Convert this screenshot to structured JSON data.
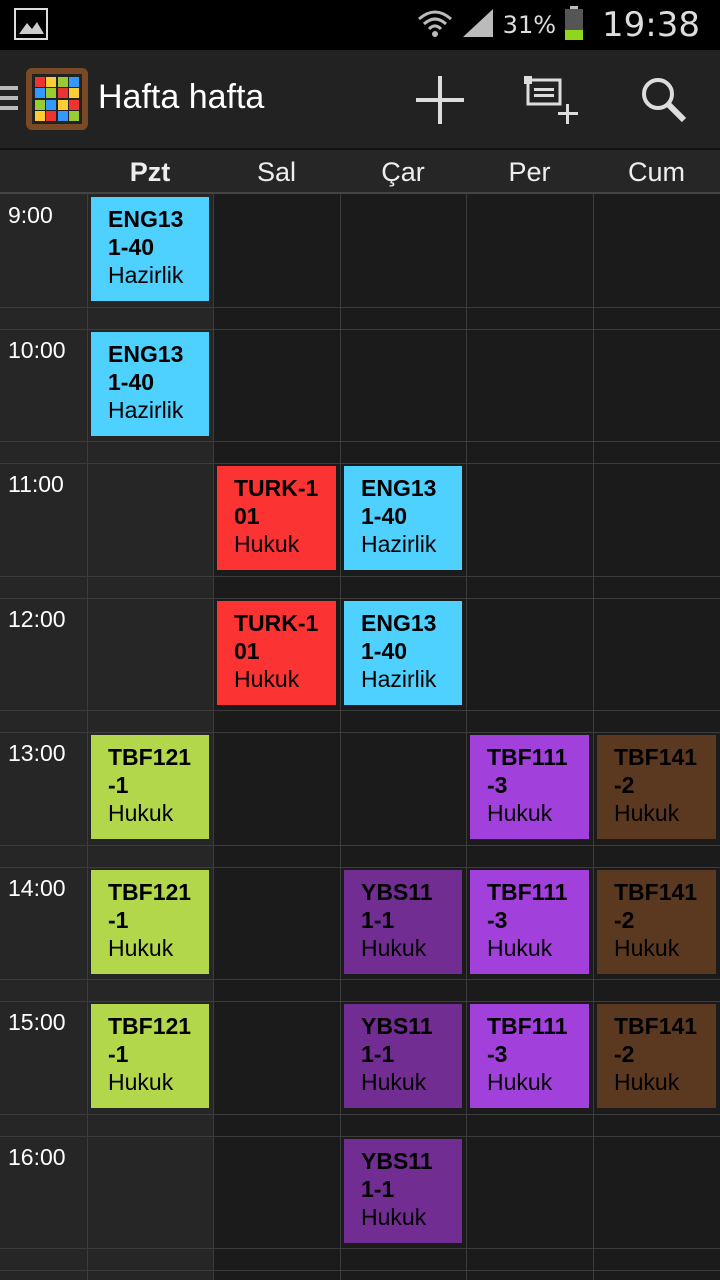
{
  "status_bar": {
    "battery_percent": "31%",
    "time": "19:38",
    "icons": [
      "image-icon",
      "wifi-icon",
      "signal-icon",
      "battery-icon"
    ]
  },
  "action_bar": {
    "title": "Hafta hafta",
    "actions": [
      {
        "name": "add-event-button",
        "icon": "plus-icon"
      },
      {
        "name": "add-list-button",
        "icon": "list-add-icon"
      },
      {
        "name": "search-button",
        "icon": "search-icon"
      }
    ]
  },
  "days": [
    {
      "label": "Pzt",
      "today": true
    },
    {
      "label": "Sal",
      "today": false
    },
    {
      "label": "Çar",
      "today": false
    },
    {
      "label": "Per",
      "today": false
    },
    {
      "label": "Cum",
      "today": false
    }
  ],
  "hours": [
    "9:00",
    "10:00",
    "11:00",
    "12:00",
    "13:00",
    "14:00",
    "15:00",
    "16:00"
  ],
  "colors": {
    "eng": "#4fd1ff",
    "turk": "#fb3333",
    "tbf121": "#b3d74a",
    "tbf111": "#a240db",
    "ybs": "#712d91",
    "tbf141": "#5a3920"
  },
  "events": [
    {
      "day": 0,
      "hour": 0,
      "code": "ENG13\n1-40",
      "room": "Hazirlik",
      "color": "eng"
    },
    {
      "day": 0,
      "hour": 1,
      "code": "ENG13\n1-40",
      "room": "Hazirlik",
      "color": "eng"
    },
    {
      "day": 1,
      "hour": 2,
      "code": "TURK-1\n01",
      "room": "Hukuk",
      "color": "turk"
    },
    {
      "day": 2,
      "hour": 2,
      "code": "ENG13\n1-40",
      "room": "Hazirlik",
      "color": "eng"
    },
    {
      "day": 1,
      "hour": 3,
      "code": "TURK-1\n01",
      "room": "Hukuk",
      "color": "turk"
    },
    {
      "day": 2,
      "hour": 3,
      "code": "ENG13\n1-40",
      "room": "Hazirlik",
      "color": "eng"
    },
    {
      "day": 0,
      "hour": 4,
      "code": "TBF121\n-1",
      "room": "Hukuk",
      "color": "tbf121"
    },
    {
      "day": 3,
      "hour": 4,
      "code": "TBF111\n-3",
      "room": "Hukuk",
      "color": "tbf111"
    },
    {
      "day": 4,
      "hour": 4,
      "code": "TBF141\n-2",
      "room": "Hukuk",
      "color": "tbf141"
    },
    {
      "day": 0,
      "hour": 5,
      "code": "TBF121\n-1",
      "room": "Hukuk",
      "color": "tbf121"
    },
    {
      "day": 2,
      "hour": 5,
      "code": "YBS11\n1-1",
      "room": "Hukuk",
      "color": "ybs"
    },
    {
      "day": 3,
      "hour": 5,
      "code": "TBF111\n-3",
      "room": "Hukuk",
      "color": "tbf111"
    },
    {
      "day": 4,
      "hour": 5,
      "code": "TBF141\n-2",
      "room": "Hukuk",
      "color": "tbf141"
    },
    {
      "day": 0,
      "hour": 6,
      "code": "TBF121\n-1",
      "room": "Hukuk",
      "color": "tbf121"
    },
    {
      "day": 2,
      "hour": 6,
      "code": "YBS11\n1-1",
      "room": "Hukuk",
      "color": "ybs"
    },
    {
      "day": 3,
      "hour": 6,
      "code": "TBF111\n-3",
      "room": "Hukuk",
      "color": "tbf111"
    },
    {
      "day": 4,
      "hour": 6,
      "code": "TBF141\n-2",
      "room": "Hukuk",
      "color": "tbf141"
    },
    {
      "day": 2,
      "hour": 7,
      "code": "YBS11\n1-1",
      "room": "Hukuk",
      "color": "ybs"
    }
  ]
}
